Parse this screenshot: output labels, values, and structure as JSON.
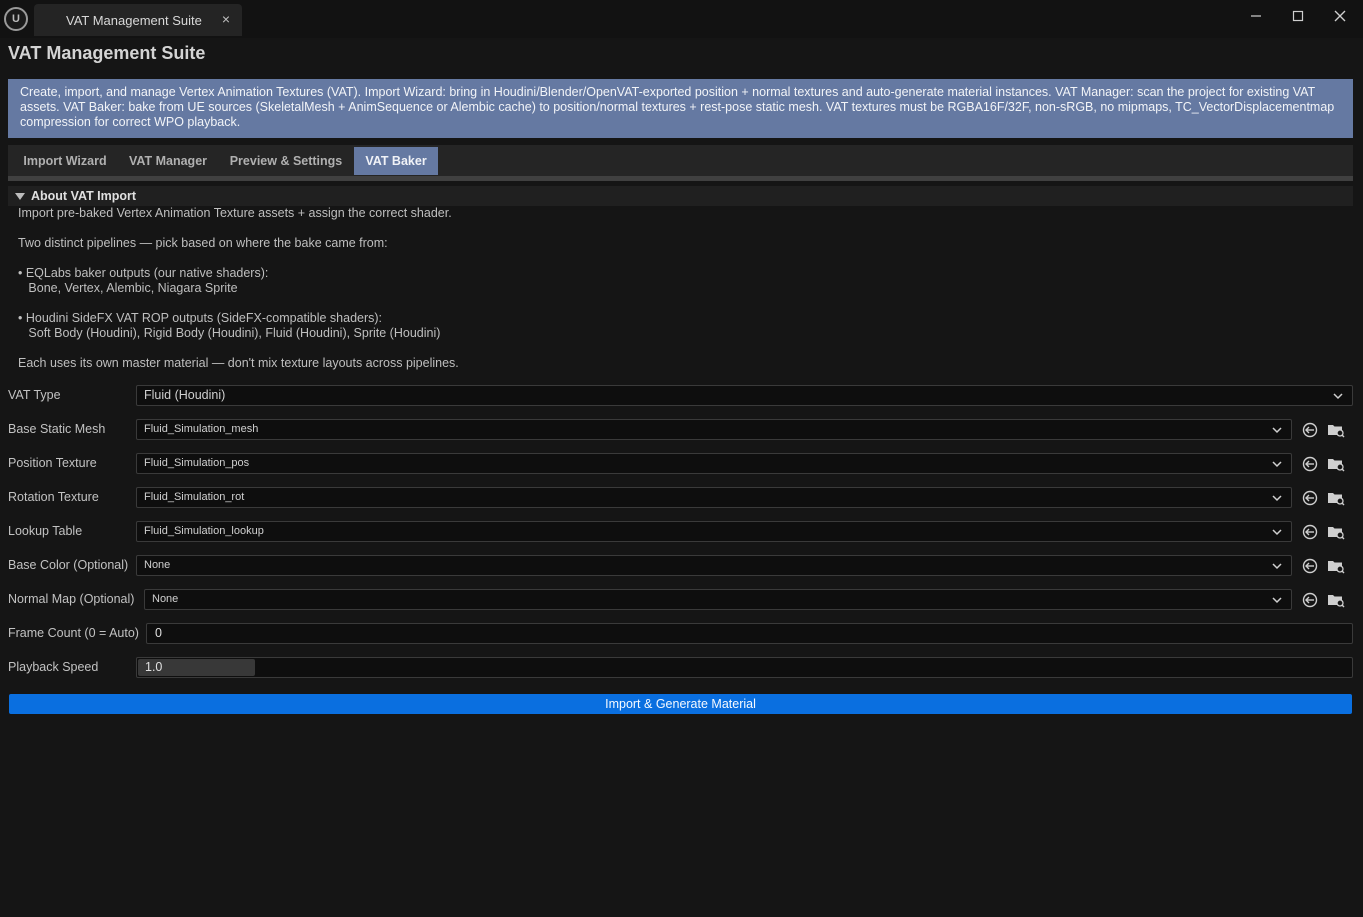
{
  "window": {
    "tab_label": "VAT Management Suite",
    "tab_close": "×",
    "logo_text": "U"
  },
  "app": {
    "title": "VAT Management Suite",
    "info": "Create, import, and manage Vertex Animation Textures (VAT). Import Wizard: bring in Houdini/Blender/OpenVAT-exported position + normal textures and auto-generate material instances. VAT Manager: scan the project for existing VAT assets. VAT Baker: bake from UE sources (SkeletalMesh + AnimSequence or Alembic cache) to position/normal textures + rest-pose static mesh. VAT textures must be RGBA16F/32F, non-sRGB, no mipmaps, TC_VectorDisplacementmap compression for correct WPO playback."
  },
  "tabs": [
    {
      "label": "Import Wizard",
      "active": false
    },
    {
      "label": "VAT Manager",
      "active": false
    },
    {
      "label": "Preview & Settings",
      "active": false
    },
    {
      "label": "VAT Baker",
      "active": true
    }
  ],
  "about": {
    "header": "About VAT Import",
    "lines": [
      "Import pre-baked Vertex Animation Texture assets + assign the correct shader.",
      "Two distinct pipelines — pick based on where the bake came from:",
      "• EQLabs baker outputs (our native shaders):",
      "   Bone, Vertex, Alembic, Niagara Sprite",
      "• Houdini SideFX VAT ROP outputs (SideFX-compatible shaders):",
      "   Soft Body (Houdini), Rigid Body (Houdini), Fluid (Houdini), Sprite (Houdini)",
      "Each uses its own master material — don't mix texture layouts across pipelines."
    ]
  },
  "form": {
    "vat_type": {
      "label": "VAT Type",
      "value": "Fluid (Houdini)"
    },
    "base_static_mesh": {
      "label": "Base Static Mesh",
      "value": "Fluid_Simulation_mesh"
    },
    "position_texture": {
      "label": "Position Texture",
      "value": "Fluid_Simulation_pos"
    },
    "rotation_texture": {
      "label": "Rotation Texture",
      "value": "Fluid_Simulation_rot"
    },
    "lookup_table": {
      "label": "Lookup Table",
      "value": "Fluid_Simulation_lookup"
    },
    "base_color": {
      "label": "Base Color (Optional)",
      "value": "None"
    },
    "normal_map": {
      "label": "Normal Map (Optional)",
      "value": "None"
    },
    "frame_count": {
      "label": "Frame Count (0 = Auto)",
      "value": "0"
    },
    "playback_speed": {
      "label": "Playback Speed",
      "value": "1.0",
      "slider_fraction": 0.096
    }
  },
  "actions": {
    "import_button": "Import & Generate Material"
  },
  "colors": {
    "accent": "#6579a2",
    "primary_button": "#0a6fe0",
    "background": "#151515"
  }
}
